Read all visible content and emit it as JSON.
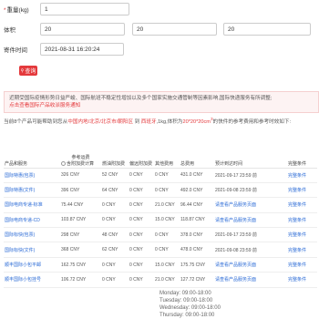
{
  "form": {
    "weight": {
      "label": "重量(kg)",
      "required_mark": "*",
      "value": "1"
    },
    "volume": {
      "label": "体积",
      "values": [
        "20",
        "20",
        "20"
      ]
    },
    "send_time": {
      "label": "寄件时间",
      "value": "2021-08-31 16:20:24"
    },
    "query_button": "查询"
  },
  "notice": {
    "text": "近期受国际疫情形势日益严峻、国际航班不稳定性增加以及多个国家实施交通管制等因素影响,国际快递服务有所调整;",
    "link": "点击查看国际产品收派服务通知"
  },
  "description": {
    "prefix": "当前8个产品可能帮助到您从",
    "route": "中国内地/北京/北京市/朝阳区",
    "middle1": " 到 ",
    "dest": "西班牙",
    "middle2": ",1kg,体积为",
    "dims": "20*20*20cm",
    "sup": "3",
    "suffix": "的快件的参考费用和参考时效如下:"
  },
  "table": {
    "headers": {
      "product": "产品和服务",
      "ref_fee": "参考运费",
      "ref_fee_sub": "含附加费计算",
      "surcharge": "燃油附加费",
      "fuel_fee": "偏远附加费",
      "other_fee": "其他费用",
      "total": "总费用",
      "eta": "预计到达时间",
      "details": "完整条件"
    },
    "rows": [
      {
        "product": "国际特惠(包票)",
        "ref_fee": "326 CNY",
        "surcharge": "52 CNY",
        "fuel_fee": "0 CNY",
        "other_fee": "0 CNY",
        "total": "431.0 CNY",
        "eta": "2021-09-17 23:59 前",
        "details": "完整条件"
      },
      {
        "product": "国际特惠(文件)",
        "ref_fee": "396 CNY",
        "surcharge": "64 CNY",
        "fuel_fee": "0 CNY",
        "other_fee": "0 CNY",
        "total": "492.0 CNY",
        "eta": "2021-09-08 23:59 前",
        "details": "完整条件"
      },
      {
        "product": "国际电商专递-标准",
        "ref_fee": "75.44 CNY",
        "surcharge": "0 CNY",
        "fuel_fee": "0 CNY",
        "other_fee": "21.0 CNY",
        "total": "96.44 CNY",
        "eta": "请查看产品服务页面",
        "details": "完整条件"
      },
      {
        "product": "国际电商专递-CD",
        "ref_fee": "103.87 CNY",
        "surcharge": "0 CNY",
        "fuel_fee": "0 CNY",
        "other_fee": "15.0 CNY",
        "total": "118.87 CNY",
        "eta": "请查看产品服务页面",
        "details": "完整条件"
      },
      {
        "product": "国际标快(包票)",
        "ref_fee": "298 CNY",
        "surcharge": "48 CNY",
        "fuel_fee": "0 CNY",
        "other_fee": "0 CNY",
        "total": "378.0 CNY",
        "eta": "2021-09-17 23:59 前",
        "details": "完整条件"
      },
      {
        "product": "国际标快(文件)",
        "ref_fee": "368 CNY",
        "surcharge": "62 CNY",
        "fuel_fee": "0 CNY",
        "other_fee": "0 CNY",
        "total": "478.0 CNY",
        "eta": "2021-09-08 23:59 前",
        "details": "完整条件"
      },
      {
        "product": "顺丰国际小包平邮",
        "ref_fee": "162.75 CNY",
        "surcharge": "0 CNY",
        "fuel_fee": "0 CNY",
        "other_fee": "15.0 CNY",
        "total": "175.75 CNY",
        "eta": "请查看产品服务页面",
        "details": "完整条件"
      },
      {
        "product": "顺丰国际小包挂号",
        "ref_fee": "106.72 CNY",
        "surcharge": "0 CNY",
        "fuel_fee": "0 CNY",
        "other_fee": "21.0 CNY",
        "total": "127.72 CNY",
        "eta": "请查看产品服务页面",
        "details": "完整条件"
      }
    ]
  },
  "hours": [
    "Monday: 09:00-18:00",
    "Tuesday: 09:00-18:00",
    "Wednesday: 09:00-18:00",
    "Thursday: 09:00-18:00"
  ],
  "colors": {
    "accent": "#e4393c",
    "link": "#2a6ad6"
  }
}
